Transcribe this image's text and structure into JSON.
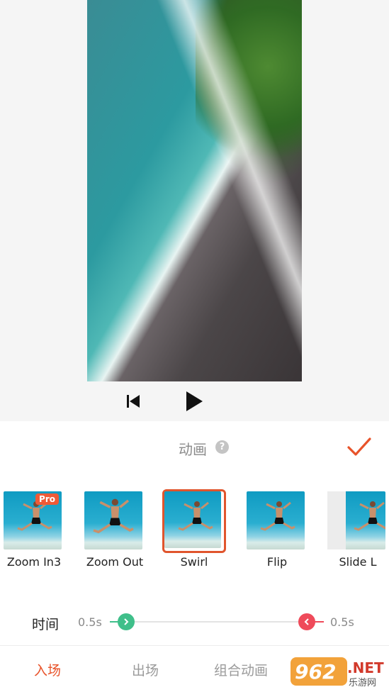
{
  "controls": {
    "prev_icon": "skip-back-icon",
    "play_icon": "play-icon"
  },
  "panel": {
    "title": "动画",
    "help_icon": "?",
    "confirm_icon": "check-icon",
    "accent_color": "#e8532a"
  },
  "effects": [
    {
      "label": "Zoom In3",
      "pro": true,
      "badge": "Pro"
    },
    {
      "label": "Zoom Out",
      "pro": false
    },
    {
      "label": "Swirl",
      "pro": false,
      "selected": true
    },
    {
      "label": "Flip",
      "pro": false
    },
    {
      "label": "Slide L",
      "pro": false
    }
  ],
  "duration": {
    "label": "时间",
    "in_value": "0.5s",
    "out_value": "0.5s",
    "in_color": "#3fbf8a",
    "out_color": "#ef4a5a"
  },
  "tabs": [
    {
      "label": "入场",
      "active": true
    },
    {
      "label": "出场",
      "active": false
    },
    {
      "label": "组合动画",
      "active": false
    }
  ],
  "watermark": {
    "text": "962.NET",
    "sub": "乐游网"
  }
}
